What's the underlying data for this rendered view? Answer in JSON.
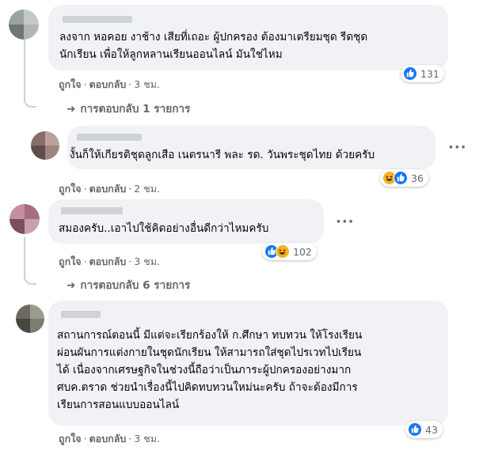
{
  "comments": [
    {
      "lines": [
        "ลงจาก หอคอย งาช้าง เสียที่เถอะ ผู้ปกครอง ต้องมาเตรียมชุด รีดชุด",
        "นักเรียน เพื่อให้ลูกหลานเรียนออนไลน์ มันใช่ไหม"
      ],
      "like": "ถูกใจ",
      "reply": "ตอบกลับ",
      "time": "3 ชม.",
      "reaction_count": "131",
      "reactions": [
        "like"
      ],
      "replies_label": "การตอบกลับ 1 รายการ"
    },
    {
      "lines": [
        "งั้นก็ให้เกียรติชุดลูกเสือ เนตรนารี พละ รด. วันพระชุดไทย ด้วยครับ"
      ],
      "like": "ถูกใจ",
      "reply": "ตอบกลับ",
      "time": "2 ชม.",
      "reaction_count": "36",
      "reactions": [
        "haha",
        "like"
      ]
    },
    {
      "lines": [
        "สมองครับ..เอาไปใช้คิดอย่างอื่นดีกว่าไหมครับ"
      ],
      "like": "ถูกใจ",
      "reply": "ตอบกลับ",
      "time": "3 ชม.",
      "reaction_count": "102",
      "reactions": [
        "like",
        "haha"
      ],
      "replies_label": "การตอบกลับ 6 รายการ"
    },
    {
      "lines": [
        "สถานการณ์ตอนนี้ มีแต่จะเรียกร้องให้ ก.ศึกษา ทบทวน ให้โรงเรียน",
        "ผ่อนผันการแต่งกายในชุดนักเรียน ให้สามารถใส่ชุดไปรเวทไปเรียน",
        "ได้ เนื่องจากเศรษฐกิจในช่วงนี้ถือว่าเป็นภาระผู้ปกครองอย่างมาก",
        "ศบค.ตราด ช่วยนำเรื่องนี้ไปคิดทบทวนใหม่นะครับ ถ้าจะต้องมีการ",
        "เรียนการสอนแบบออนไลน์"
      ],
      "like": "ถูกใจ",
      "reply": "ตอบกลับ",
      "time": "3 ชม.",
      "reaction_count": "43",
      "reactions": [
        "like"
      ]
    }
  ],
  "icons": {
    "more": "more-horizontal-icon",
    "like": "thumbs-up-icon",
    "haha": "laughing-face-icon",
    "reply_arrow": "reply-arrow-icon"
  },
  "colors": {
    "like_blue": "#1877f2",
    "haha_yellow": "#f7b125",
    "bubble": "#f0f2f5",
    "meta_gray": "#65676b"
  }
}
